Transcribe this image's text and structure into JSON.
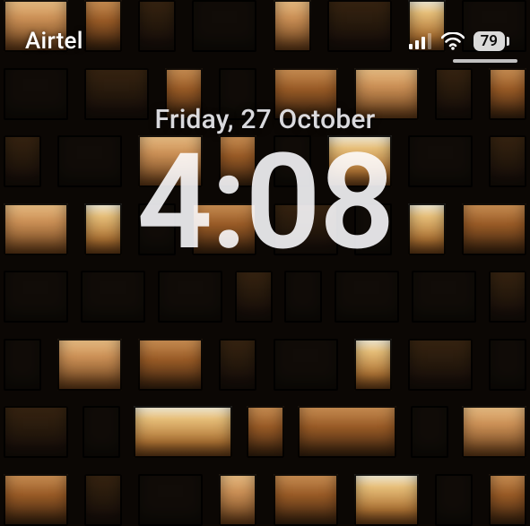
{
  "status_bar": {
    "carrier": "Airtel",
    "signal_bars": 3,
    "wifi_bars": 3,
    "battery_percent": "79"
  },
  "lockscreen": {
    "date": "Friday, 27 October",
    "time": "4:08"
  }
}
